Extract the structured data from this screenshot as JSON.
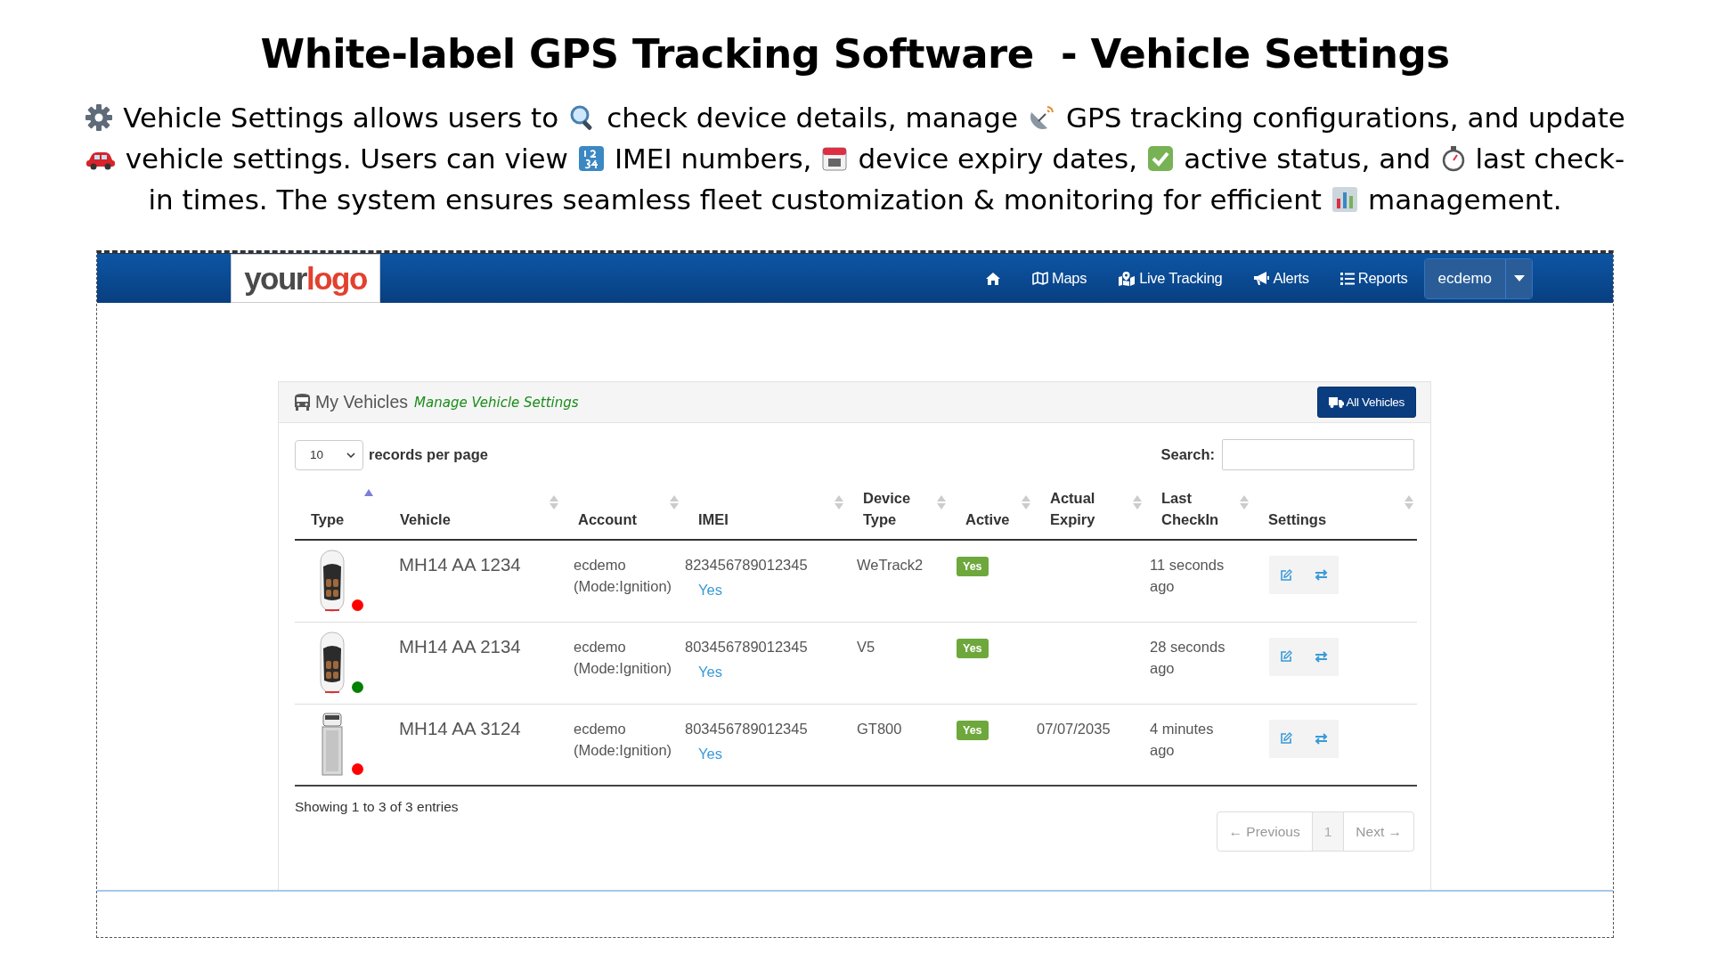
{
  "headline": {
    "title": "White-label GPS Tracking Software  - Vehicle Settings",
    "description_lines": [
      [
        {
          "kind": "icon"
        },
        {
          "kind": "text",
          "text": "Vehicle Settings allows users to"
        },
        {
          "kind": "icon"
        },
        {
          "kind": "text",
          "text": "check device details, manage"
        },
        {
          "kind": "icon"
        },
        {
          "kind": "text",
          "text": "GPS tracking configurations, and update"
        }
      ],
      [
        {
          "kind": "icon"
        },
        {
          "kind": "text",
          "text": "vehicle settings. Users can view"
        },
        {
          "kind": "icon"
        },
        {
          "kind": "text",
          "text": "IMEI numbers,"
        },
        {
          "kind": "icon"
        },
        {
          "kind": "text",
          "text": "device expiry dates,"
        },
        {
          "kind": "icon"
        },
        {
          "kind": "text",
          "text": "active status, and"
        },
        {
          "kind": "icon"
        },
        {
          "kind": "text",
          "text": "last check-"
        }
      ],
      [
        {
          "kind": "text",
          "text": "in times. The system ensures seamless fleet customization & monitoring for efficient"
        },
        {
          "kind": "icon"
        },
        {
          "kind": "text",
          "text": "management."
        }
      ]
    ]
  },
  "navbar": {
    "logo": {
      "first": "your",
      "second": "logo"
    },
    "items": [
      {
        "kind": "icon"
      },
      {
        "kind": "link",
        "label": "Maps"
      },
      {
        "kind": "link",
        "label": "Live Tracking"
      },
      {
        "kind": "link",
        "label": "Alerts"
      },
      {
        "kind": "link",
        "label": "Reports"
      }
    ],
    "user_button": "ecdemo"
  },
  "panel": {
    "title": "My Vehicles",
    "subtitle": "Manage Vehicle Settings",
    "all_button": "All Vehicles",
    "page_size": "10",
    "page_size_label": "records per page",
    "search_label": "Search:",
    "columns": [
      {
        "label": "Type",
        "sorted": true
      },
      {
        "label": "Vehicle",
        "sorted": false
      },
      {
        "label": "Account",
        "sorted": false
      },
      {
        "label": "IMEI",
        "sorted": false
      },
      {
        "label": "Device Type",
        "sorted": false
      },
      {
        "label": "Active",
        "sorted": false
      },
      {
        "label": "Actual Expiry",
        "sorted": false
      },
      {
        "label": "Last CheckIn",
        "sorted": false
      },
      {
        "label": "Settings",
        "sorted": false
      }
    ],
    "rows": [
      {
        "kind": "car",
        "color": "#ff0000",
        "vehicle": "MH14 AA 1234",
        "account": "ecdemo",
        "mode": "(Mode:Ignition)",
        "imei": "823456789012345",
        "imei_link": "Yes",
        "device_type": "WeTrack2",
        "active": "Yes",
        "checkin": "11 seconds ago"
      },
      {
        "kind": "car",
        "color": "#008000",
        "vehicle": "MH14 AA 2134",
        "account": "ecdemo",
        "mode": "(Mode:Ignition)",
        "imei": "803456789012345",
        "imei_link": "Yes",
        "device_type": "V5",
        "active": "Yes",
        "checkin": "28 seconds ago"
      },
      {
        "kind": "van",
        "color": "#ff0000",
        "vehicle": "MH14 AA 3124",
        "account": "ecdemo",
        "mode": "(Mode:Ignition)",
        "imei": "803456789012345",
        "imei_link": "Yes",
        "device_type": "GT800",
        "active": "Yes",
        "expiry": "07/07/2035",
        "checkin": "4 minutes ago"
      }
    ],
    "info": "Showing 1 to 3 of 3 entries",
    "pagination": [
      {
        "label": "← Previous",
        "selected": false
      },
      {
        "label": "1",
        "selected": true
      },
      {
        "label": "Next →",
        "selected": false
      }
    ]
  }
}
